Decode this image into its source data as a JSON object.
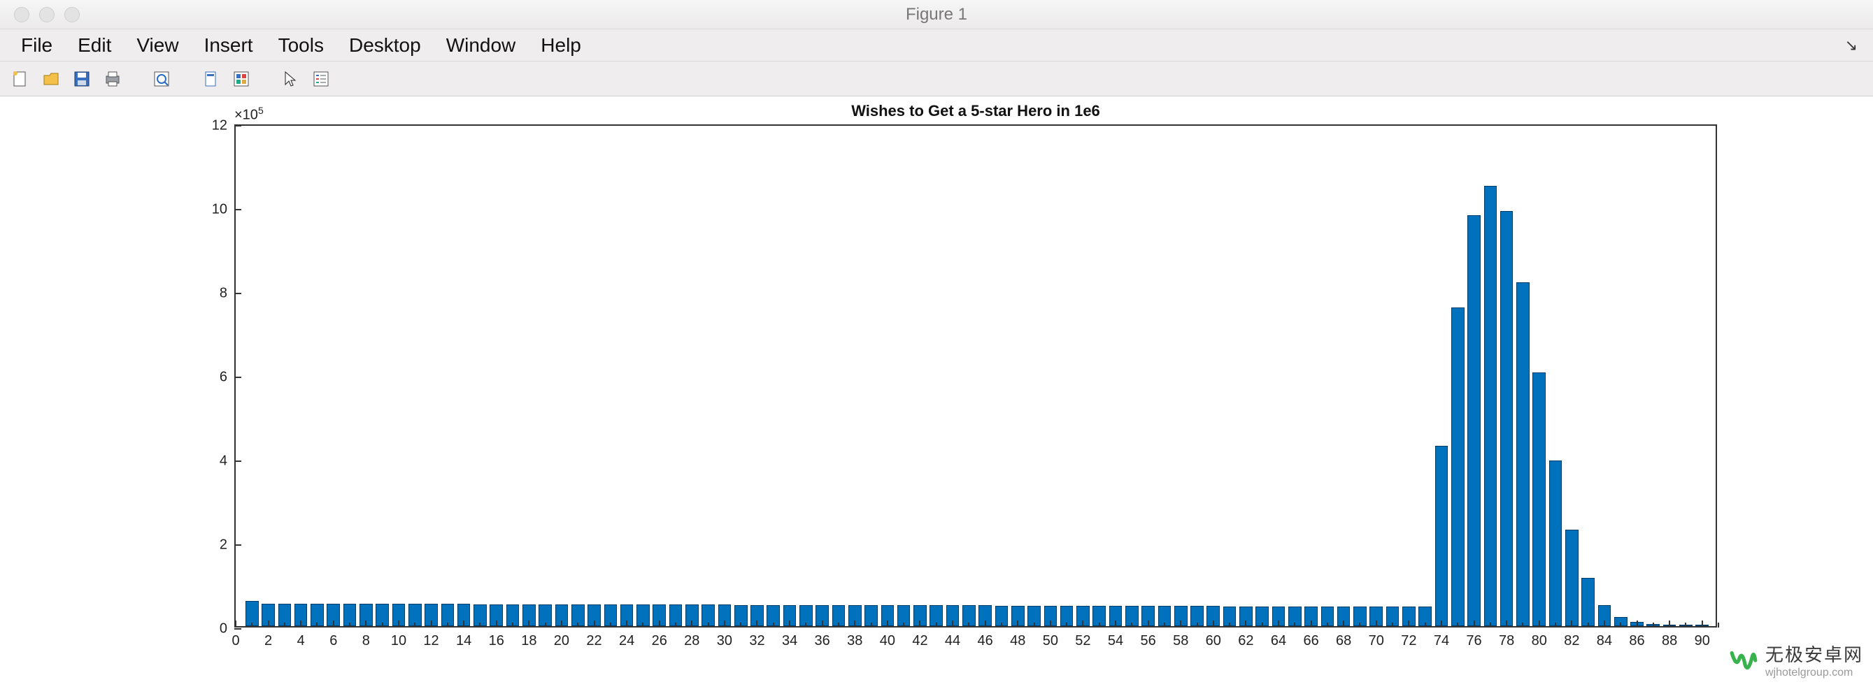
{
  "window": {
    "title": "Figure 1"
  },
  "menubar": {
    "items": [
      "File",
      "Edit",
      "View",
      "Insert",
      "Tools",
      "Desktop",
      "Window",
      "Help"
    ]
  },
  "toolbar": {
    "buttons": [
      "new",
      "open",
      "save",
      "print",
      "print-preview",
      "link",
      "table",
      "cursor",
      "legend"
    ]
  },
  "chart_data": {
    "type": "bar",
    "title": "Wishes to Get a 5-star Hero in 1e6",
    "xlabel": "",
    "ylabel": "",
    "y_exponent_label": "×10^5",
    "xlim": [
      0,
      91
    ],
    "ylim": [
      0,
      1200000
    ],
    "xticks_major": [
      0,
      2,
      4,
      6,
      8,
      10,
      12,
      14,
      16,
      18,
      20,
      22,
      24,
      26,
      28,
      30,
      32,
      34,
      36,
      38,
      40,
      42,
      44,
      46,
      48,
      50,
      52,
      54,
      56,
      58,
      60,
      62,
      64,
      66,
      68,
      70,
      72,
      74,
      76,
      78,
      80,
      82,
      84,
      86,
      88,
      90
    ],
    "yticks": [
      0,
      200000,
      400000,
      600000,
      800000,
      1000000,
      1200000
    ],
    "ytick_labels": [
      "0",
      "2",
      "4",
      "6",
      "8",
      "10",
      "12"
    ],
    "categories": [
      1,
      2,
      3,
      4,
      5,
      6,
      7,
      8,
      9,
      10,
      11,
      12,
      13,
      14,
      15,
      16,
      17,
      18,
      19,
      20,
      21,
      22,
      23,
      24,
      25,
      26,
      27,
      28,
      29,
      30,
      31,
      32,
      33,
      34,
      35,
      36,
      37,
      38,
      39,
      40,
      41,
      42,
      43,
      44,
      45,
      46,
      47,
      48,
      49,
      50,
      51,
      52,
      53,
      54,
      55,
      56,
      57,
      58,
      59,
      60,
      61,
      62,
      63,
      64,
      65,
      66,
      67,
      68,
      69,
      70,
      71,
      72,
      73,
      74,
      75,
      76,
      77,
      78,
      79,
      80,
      81,
      82,
      83,
      84,
      85,
      86,
      87,
      88,
      89,
      90
    ],
    "values": [
      60000,
      54000,
      54000,
      54000,
      54000,
      54000,
      54000,
      54000,
      54000,
      54000,
      54000,
      54000,
      54000,
      54000,
      52000,
      52000,
      52000,
      52000,
      52000,
      52000,
      52000,
      52000,
      52000,
      52000,
      52000,
      52000,
      52000,
      52000,
      52000,
      52000,
      50000,
      50000,
      50000,
      50000,
      50000,
      50000,
      50000,
      50000,
      50000,
      50000,
      50000,
      50000,
      50000,
      50000,
      50000,
      50000,
      48000,
      48000,
      48000,
      48000,
      48000,
      48000,
      48000,
      48000,
      48000,
      48000,
      48000,
      48000,
      48000,
      48000,
      46000,
      46000,
      46000,
      46000,
      46000,
      46000,
      46000,
      46000,
      46000,
      46000,
      46000,
      46000,
      46000,
      430000,
      760000,
      980000,
      1050000,
      990000,
      820000,
      605000,
      395000,
      230000,
      115000,
      50000,
      22000,
      10000,
      5000,
      2000,
      1000,
      500
    ]
  },
  "watermark": {
    "name": "无极安卓网",
    "url": "wjhotelgroup.com"
  }
}
